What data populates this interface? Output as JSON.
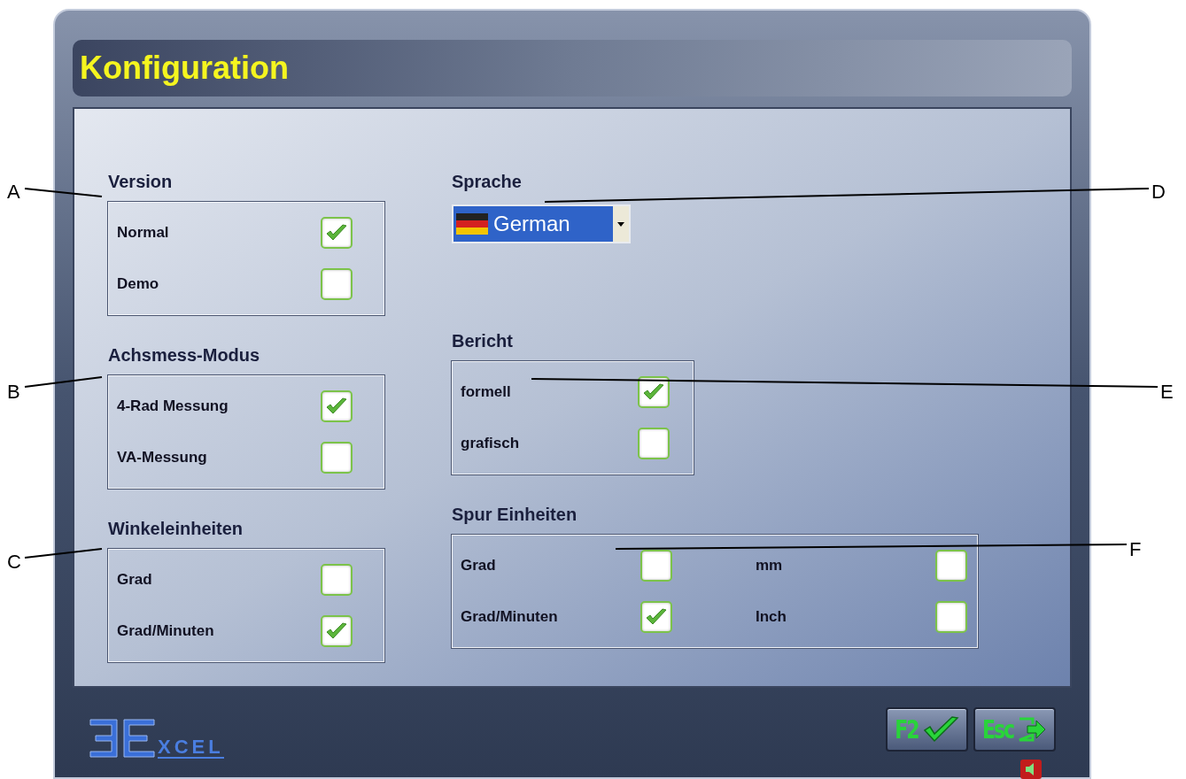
{
  "window": {
    "title": "Konfiguration"
  },
  "groups": [
    {
      "title": "Version",
      "columns": [
        [
          {
            "label": "Normal",
            "checked": true
          },
          {
            "label": "Demo",
            "checked": false
          }
        ]
      ]
    },
    {
      "title": "Achsmess-Modus",
      "columns": [
        [
          {
            "label": "4-Rad Messung",
            "checked": true
          },
          {
            "label": "VA-Messung",
            "checked": false
          }
        ]
      ]
    },
    {
      "title": "Winkeleinheiten",
      "columns": [
        [
          {
            "label": "Grad",
            "checked": false
          },
          {
            "label": "Grad/Minuten",
            "checked": true
          }
        ]
      ]
    },
    {
      "title": "Bericht",
      "columns": [
        [
          {
            "label": "formell",
            "checked": true
          },
          {
            "label": "grafisch",
            "checked": false
          }
        ]
      ]
    },
    {
      "title": "Spur Einheiten",
      "columns": [
        [
          {
            "label": "Grad",
            "checked": false
          },
          {
            "label": "Grad/Minuten",
            "checked": true
          }
        ],
        [
          {
            "label": "mm",
            "checked": false
          },
          {
            "label": "Inch",
            "checked": false
          }
        ]
      ]
    }
  ],
  "language": {
    "label": "Sprache",
    "value": "German"
  },
  "footer": {
    "logo_text": "XCEL",
    "buttons": [
      {
        "key": "F2",
        "kind": "confirm"
      },
      {
        "key": "Esc",
        "kind": "exit"
      }
    ]
  },
  "callouts": [
    "A",
    "B",
    "C",
    "D",
    "E",
    "F"
  ]
}
